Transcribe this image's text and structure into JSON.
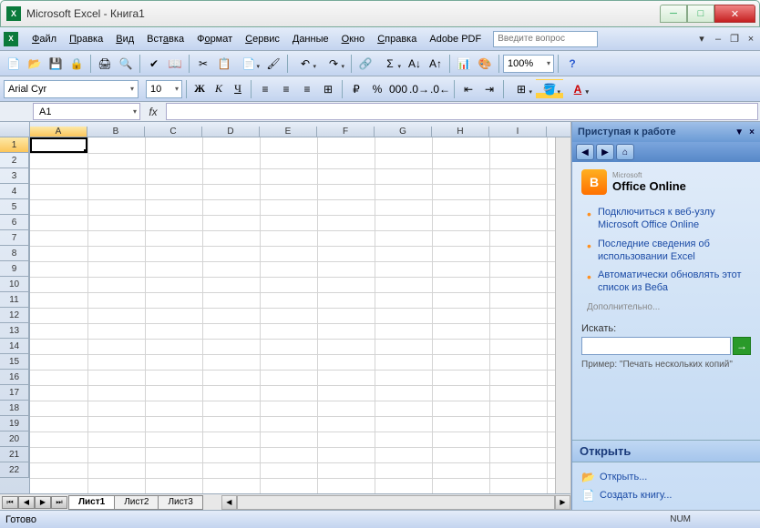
{
  "title": "Microsoft Excel - Книга1",
  "menus": [
    "Файл",
    "Правка",
    "Вид",
    "Вставка",
    "Формат",
    "Сервис",
    "Данные",
    "Окно",
    "Справка",
    "Adobe PDF"
  ],
  "menu_underline_idx": [
    0,
    0,
    0,
    3,
    1,
    0,
    0,
    0,
    0,
    null
  ],
  "search_placeholder": "Введите вопрос",
  "font_name": "Arial Cyr",
  "font_size": "10",
  "zoom": "100%",
  "namebox": "A1",
  "fx_label": "fx",
  "columns": [
    "A",
    "B",
    "C",
    "D",
    "E",
    "F",
    "G",
    "H",
    "I"
  ],
  "rows_count": 22,
  "selected_col": 0,
  "selected_row": 0,
  "sheets": [
    "Лист1",
    "Лист2",
    "Лист3"
  ],
  "active_sheet": 0,
  "taskpane": {
    "title": "Приступая к работе",
    "office_online": "Office Online",
    "office_prefix": "Microsoft",
    "links": [
      "Подключиться к веб-узлу Microsoft Office Online",
      "Последние сведения об использовании Excel",
      "Автоматически обновлять этот список из Веба"
    ],
    "more": "Дополнительно...",
    "search_label": "Искать:",
    "example_label": "Пример:",
    "example_text": "\"Печать нескольких копий\"",
    "open_section": "Открыть",
    "open_link": "Открыть...",
    "new_link": "Создать книгу..."
  },
  "status": {
    "ready": "Готово",
    "num": "NUM"
  }
}
